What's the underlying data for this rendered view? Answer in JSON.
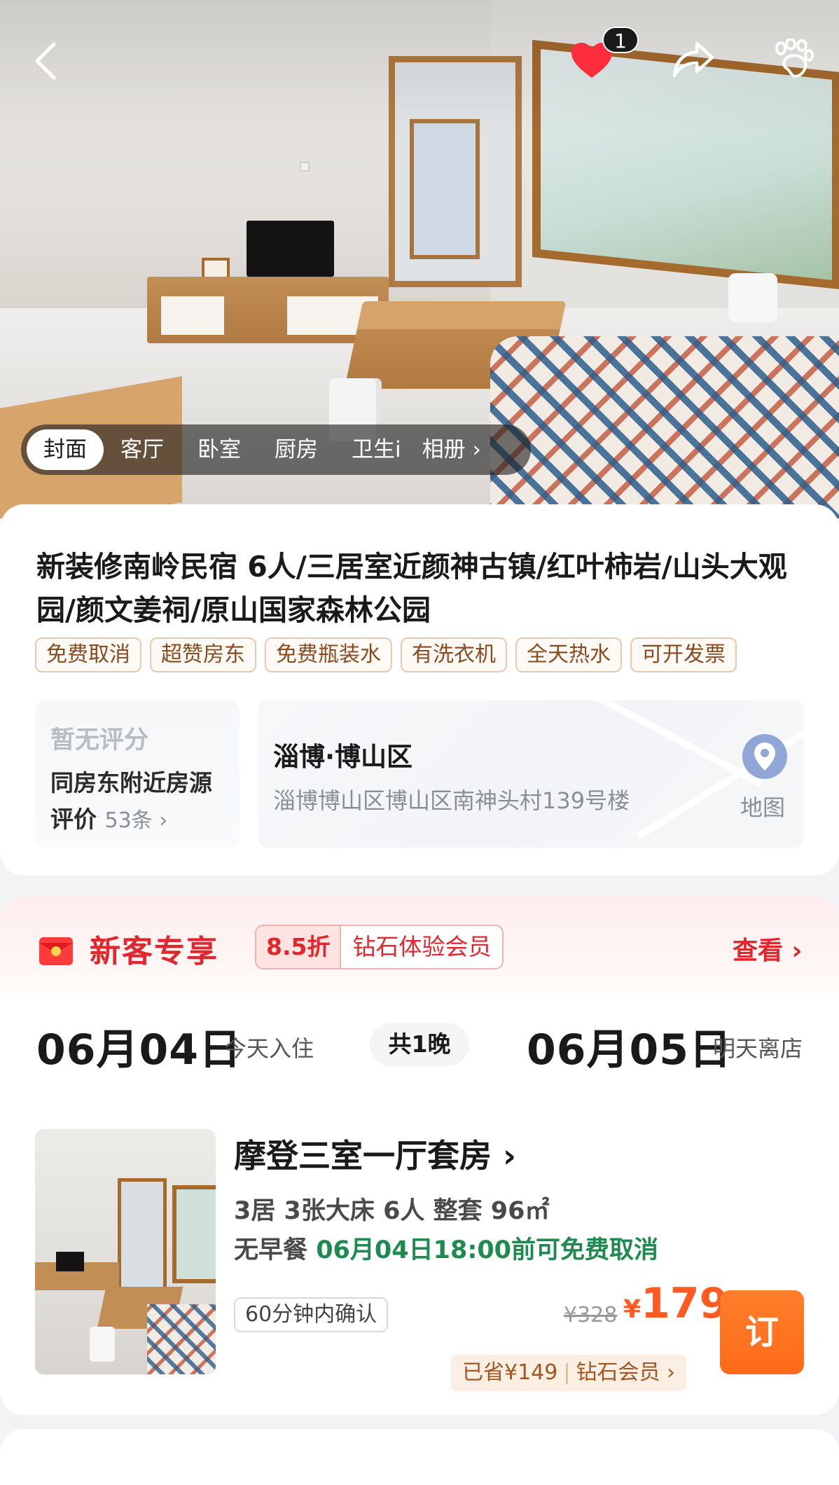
{
  "hero": {
    "favorite_count": "1",
    "album_tabs": [
      "封面",
      "客厅",
      "卧室",
      "厨房",
      "卫生i"
    ],
    "album_more": "相册 ›"
  },
  "listing": {
    "title": "新装修南岭民宿 6人/三居室近颜神古镇/红叶柿岩/山头大观园/颜文姜祠/原山国家森林公园",
    "tags": [
      "免费取消",
      "超赞房东",
      "免费瓶装水",
      "有洗衣机",
      "全天热水",
      "可开发票"
    ],
    "rating": {
      "none_label": "暂无评分",
      "nearby_label": "同房东附近房源评价",
      "count": "53条 ›"
    },
    "location": {
      "city": "淄博·博山区",
      "address": "淄博博山区博山区南神头村139号楼",
      "map_label": "地图"
    }
  },
  "promo": {
    "title": "新客专享",
    "discount": "8.5折",
    "member": "钻石体验会员",
    "more": "查看 ›"
  },
  "dates": {
    "checkin": "06月04日",
    "checkin_label": "今天入住",
    "nights": "共1晚",
    "checkout": "06月05日",
    "checkout_label": "明天离店"
  },
  "room": {
    "name": "摩登三室一厅套房 ›",
    "specs": "3居 3张大床 6人 整套 96㎡",
    "breakfast": "无早餐",
    "cancel_policy": "06月04日18:00前可免费取消",
    "confirm": "60分钟内确认",
    "price_old": "¥328",
    "price_symbol": "¥",
    "price": "179",
    "saved": "已省¥149",
    "saved_member": "钻石会员 ›",
    "book_label": "订"
  },
  "colors": {
    "accent_red": "#e3262e",
    "price_orange": "#ff5a1f",
    "cancel_green": "#1e8a4f"
  }
}
